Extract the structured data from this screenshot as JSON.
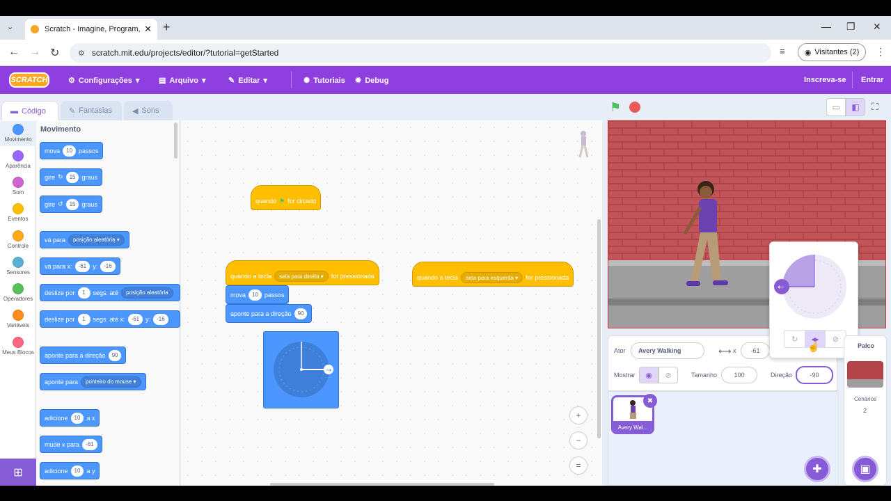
{
  "browser": {
    "tab_title": "Scratch - Imagine, Program, Sh",
    "url": "scratch.mit.edu/projects/editor/?tutorial=getStarted",
    "visitors_label": "Visitantes (2)"
  },
  "menubar": {
    "logo": "SCRATCH",
    "settings": "Configurações",
    "file": "Arquivo",
    "edit": "Editar",
    "tutorials": "Tutoriais",
    "debug": "Debug",
    "signup": "Inscreva-se",
    "signin": "Entrar"
  },
  "tabs": {
    "code": "Código",
    "costumes": "Fantasias",
    "sounds": "Sons"
  },
  "categories": [
    {
      "label": "Movimento",
      "color": "#4c97ff"
    },
    {
      "label": "Aparência",
      "color": "#9966ff"
    },
    {
      "label": "Som",
      "color": "#cf63cf"
    },
    {
      "label": "Eventos",
      "color": "#ffbf00"
    },
    {
      "label": "Controle",
      "color": "#ffab19"
    },
    {
      "label": "Sensores",
      "color": "#5cb1d6"
    },
    {
      "label": "Operadores",
      "color": "#59c059"
    },
    {
      "label": "Variáveis",
      "color": "#ff8c1a"
    },
    {
      "label": "Meus Blocos",
      "color": "#ff6680"
    }
  ],
  "palette": {
    "title": "Movimento",
    "move": {
      "a": "mova",
      "v": "10",
      "b": "passos"
    },
    "turn_right": {
      "a": "gire",
      "v": "15",
      "b": "graus"
    },
    "turn_left": {
      "a": "gire",
      "v": "15",
      "b": "graus"
    },
    "goto": {
      "a": "vá para",
      "dd": "posição aleatória"
    },
    "gotoxy": {
      "a": "vá para x:",
      "x": "-61",
      "b": "y:",
      "y": "-16"
    },
    "glide1": {
      "a": "deslize por",
      "v": "1",
      "b": "segs. até",
      "dd": "posição aleatória"
    },
    "glide2": {
      "a": "deslize por",
      "v": "1",
      "b": "segs. até x:",
      "x": "-61",
      "c": "y:",
      "y": "-16"
    },
    "point_dir": {
      "a": "aponte para a direção",
      "v": "90"
    },
    "point_to": {
      "a": "aponte para",
      "dd": "ponteiro do mouse"
    },
    "change_x": {
      "a": "adicione",
      "v": "10",
      "b": "a x"
    },
    "set_x": {
      "a": "mude x para",
      "v": "-61"
    },
    "change_y": {
      "a": "adicione",
      "v": "10",
      "b": "a y"
    }
  },
  "script": {
    "flag_hat": {
      "a": "quando",
      "b": "for clicado"
    },
    "key_right": {
      "a": "quando a tecla",
      "dd": "seta para direita",
      "b": "for pressionada"
    },
    "move": {
      "a": "mova",
      "v": "10",
      "b": "passos"
    },
    "point": {
      "a": "aponte para a direção",
      "v": "90"
    },
    "key_left": {
      "a": "quando a tecla",
      "dd": "seta para esquerda",
      "b": "for pressionada"
    }
  },
  "sprite_info": {
    "sprite_label": "Ator",
    "sprite_name": "Avery Walking",
    "x_label": "x",
    "x_value": "-61",
    "show_label": "Mostrar",
    "size_label": "Tamanho",
    "size_value": "100",
    "direction_label": "Direção",
    "direction_value": "-90"
  },
  "sprite_thumb": "Avery Wal...",
  "stage_panel": {
    "title": "Palco",
    "backdrops_label": "Cenários",
    "backdrops_count": "2"
  },
  "zoom": {
    "in": "+",
    "out": "−",
    "reset": "="
  }
}
